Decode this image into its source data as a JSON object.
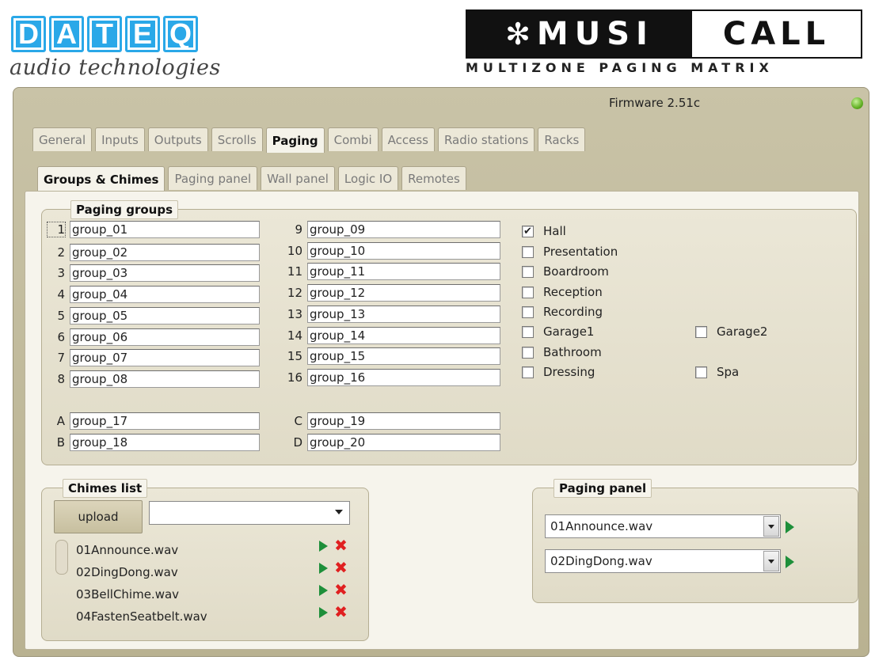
{
  "header": {
    "brand_letters": [
      "D",
      "A",
      "T",
      "E",
      "Q"
    ],
    "brand_sub": "audio technologies",
    "product_left": "MUSI",
    "product_right": "CALL",
    "product_sub": "MULTIZONE PAGING MATRIX"
  },
  "firmware": "Firmware 2.51c",
  "colors": {
    "status_led": "#62b024",
    "brand_blue": "#2aa8e8",
    "play": "#1e8f3a",
    "delete": "#e02020"
  },
  "tabs": [
    "General",
    "Inputs",
    "Outputs",
    "Scrolls",
    "Paging",
    "Combi",
    "Access",
    "Radio stations",
    "Racks"
  ],
  "active_tab": "Paging",
  "subtabs": [
    "Groups & Chimes",
    "Paging panel",
    "Wall panel",
    "Logic IO",
    "Remotes"
  ],
  "active_subtab": "Groups & Chimes",
  "paging_groups": {
    "legend": "Paging groups",
    "left": [
      {
        "idx": "1",
        "value": "group_01"
      },
      {
        "idx": "2",
        "value": "group_02"
      },
      {
        "idx": "3",
        "value": "group_03"
      },
      {
        "idx": "4",
        "value": "group_04"
      },
      {
        "idx": "5",
        "value": "group_05"
      },
      {
        "idx": "6",
        "value": "group_06"
      },
      {
        "idx": "7",
        "value": "group_07"
      },
      {
        "idx": "8",
        "value": "group_08"
      },
      {
        "idx": "A",
        "value": "group_17"
      },
      {
        "idx": "B",
        "value": "group_18"
      }
    ],
    "right": [
      {
        "idx": "9",
        "value": "group_09"
      },
      {
        "idx": "10",
        "value": "group_10"
      },
      {
        "idx": "11",
        "value": "group_11"
      },
      {
        "idx": "12",
        "value": "group_12"
      },
      {
        "idx": "13",
        "value": "group_13"
      },
      {
        "idx": "14",
        "value": "group_14"
      },
      {
        "idx": "15",
        "value": "group_15"
      },
      {
        "idx": "16",
        "value": "group_16"
      },
      {
        "idx": "C",
        "value": "group_19"
      },
      {
        "idx": "D",
        "value": "group_20"
      }
    ],
    "zones_col1": [
      {
        "label": "Hall",
        "checked": true
      },
      {
        "label": "Presentation",
        "checked": false
      },
      {
        "label": "Boardroom",
        "checked": false
      },
      {
        "label": "Reception",
        "checked": false
      },
      {
        "label": "Recording",
        "checked": false
      },
      {
        "label": "Garage1",
        "checked": false
      },
      {
        "label": "Bathroom",
        "checked": false
      },
      {
        "label": "Dressing",
        "checked": false
      }
    ],
    "zones_col2": [
      {
        "label": "Garage2",
        "checked": false
      },
      {
        "label": "Spa",
        "checked": false
      }
    ]
  },
  "chimes": {
    "legend": "Chimes list",
    "upload_label": "upload",
    "select_value": "",
    "items": [
      "01Announce.wav",
      "02DingDong.wav",
      "03BellChime.wav",
      "04FastenSeatbelt.wav"
    ]
  },
  "paging_panel": {
    "legend": "Paging panel",
    "selects": [
      "01Announce.wav",
      "02DingDong.wav"
    ]
  }
}
